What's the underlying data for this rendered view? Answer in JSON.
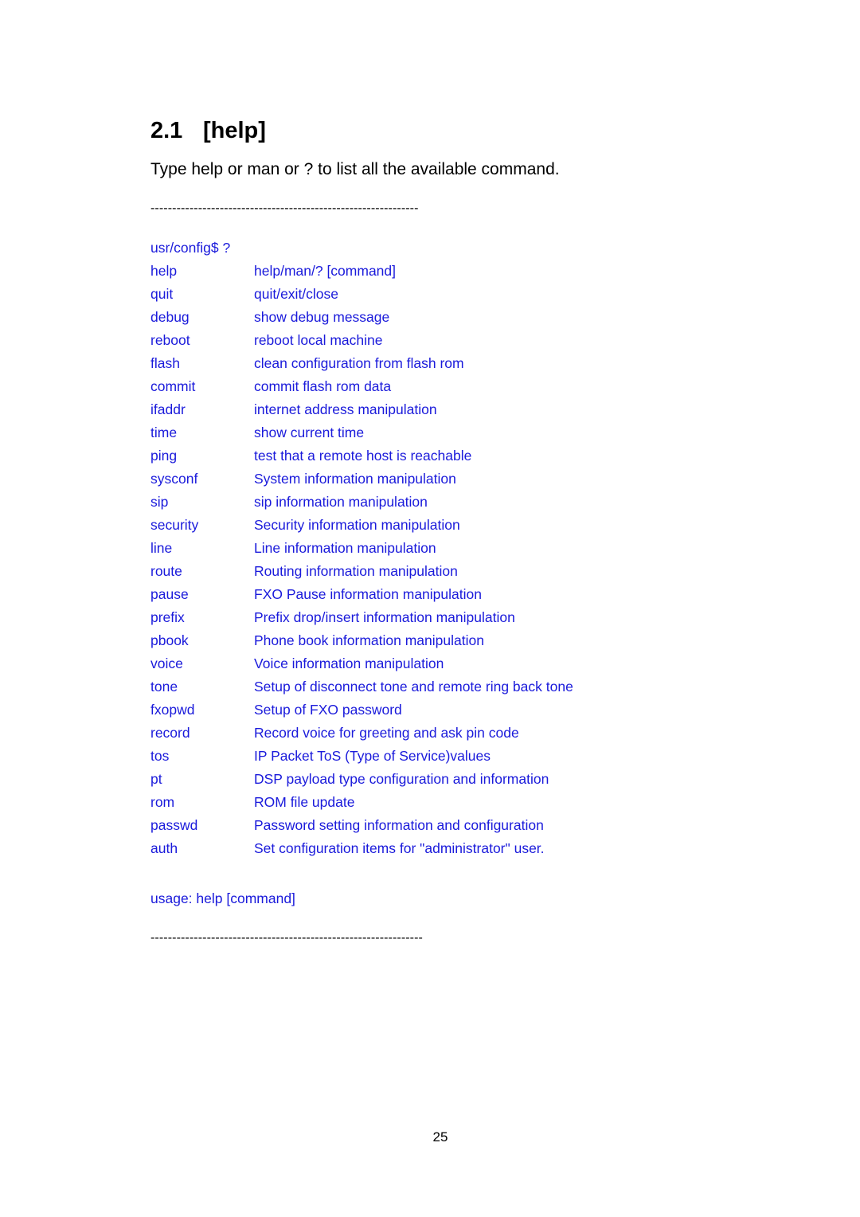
{
  "section": {
    "number": "2.1",
    "title": "[help]"
  },
  "intro": "Type help or man or ? to list all the available command.",
  "rule_top": "--------------------------------------------------------------",
  "terminal": {
    "prompt": "usr/config$ ?",
    "colors": {
      "text": "#1a1adb"
    },
    "commands": [
      {
        "cmd": "help",
        "desc": "help/man/? [command]"
      },
      {
        "cmd": "quit",
        "desc": "quit/exit/close"
      },
      {
        "cmd": "debug",
        "desc": "show debug message"
      },
      {
        "cmd": "reboot",
        "desc": "reboot local machine"
      },
      {
        "cmd": "flash",
        "desc": "clean configuration from flash rom"
      },
      {
        "cmd": "commit",
        "desc": "commit flash rom data"
      },
      {
        "cmd": "ifaddr",
        "desc": "internet address manipulation"
      },
      {
        "cmd": "time",
        "desc": "show current time"
      },
      {
        "cmd": "ping",
        "desc": "test that a remote host is reachable"
      },
      {
        "cmd": "sysconf",
        "desc": "System information manipulation"
      },
      {
        "cmd": "sip",
        "desc": "sip information manipulation"
      },
      {
        "cmd": "security",
        "desc": "Security information manipulation"
      },
      {
        "cmd": "line",
        "desc": "Line information manipulation"
      },
      {
        "cmd": "route",
        "desc": "Routing information manipulation"
      },
      {
        "cmd": "pause",
        "desc": "FXO Pause information manipulation"
      },
      {
        "cmd": "prefix",
        "desc": "Prefix drop/insert information manipulation"
      },
      {
        "cmd": "pbook",
        "desc": "Phone book information manipulation"
      },
      {
        "cmd": "voice",
        "desc": "Voice information manipulation"
      },
      {
        "cmd": "tone",
        "desc": "Setup of disconnect tone and remote ring back tone"
      },
      {
        "cmd": "fxopwd",
        "desc": "Setup of FXO password"
      },
      {
        "cmd": "record",
        "desc": "Record voice for greeting and ask pin code"
      },
      {
        "cmd": "tos",
        "desc": "IP Packet ToS (Type of Service)values"
      },
      {
        "cmd": "pt",
        "desc": "DSP payload type configuration and information"
      },
      {
        "cmd": "rom",
        "desc": "ROM file update"
      },
      {
        "cmd": "passwd",
        "desc": "Password setting information and configuration"
      },
      {
        "cmd": "auth",
        "desc": "Set configuration items for \"administrator\" user."
      }
    ],
    "usage": "usage: help [command]"
  },
  "rule_bottom": "---------------------------------------------------------------",
  "page_number": "25"
}
